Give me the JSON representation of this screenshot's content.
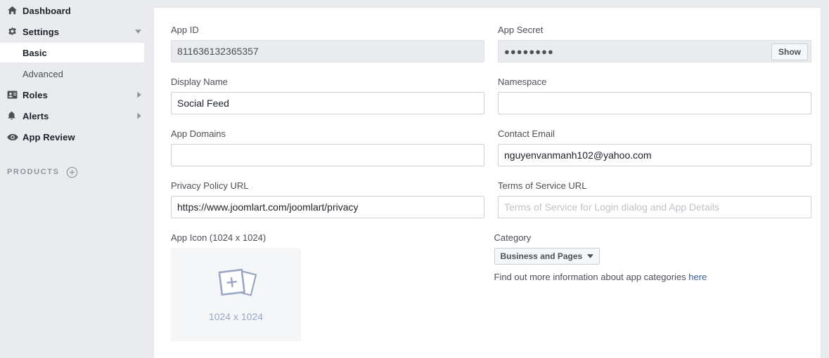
{
  "sidebar": {
    "items": [
      {
        "label": "Dashboard",
        "icon": "home-icon",
        "has_caret": false,
        "caret": ""
      },
      {
        "label": "Settings",
        "icon": "gear-icon",
        "has_caret": true,
        "caret": "down"
      },
      {
        "label": "Roles",
        "icon": "id-card-icon",
        "has_caret": true,
        "caret": "right"
      },
      {
        "label": "Alerts",
        "icon": "bell-icon",
        "has_caret": true,
        "caret": "right"
      },
      {
        "label": "App Review",
        "icon": "eye-icon",
        "has_caret": false,
        "caret": ""
      }
    ],
    "settings_children": [
      {
        "label": "Basic",
        "selected": true
      },
      {
        "label": "Advanced",
        "selected": false
      }
    ],
    "products": {
      "label": "PRODUCTS",
      "add_icon": "plus-circle-icon"
    },
    "background_color": "#e9ebee",
    "selected_background": "#ffffff"
  },
  "form": {
    "app_id": {
      "label": "App ID",
      "value": "811636132365357",
      "disabled": true
    },
    "app_secret": {
      "label": "App Secret",
      "value": "●●●●●●●●",
      "show_button_label": "Show",
      "disabled": true
    },
    "display_name": {
      "label": "Display Name",
      "value": "Social Feed",
      "placeholder": ""
    },
    "namespace": {
      "label": "Namespace",
      "value": "",
      "placeholder": ""
    },
    "app_domains": {
      "label": "App Domains",
      "value": "",
      "placeholder": ""
    },
    "contact_email": {
      "label": "Contact Email",
      "value": "nguyenvanmanh102@yahoo.com",
      "placeholder": ""
    },
    "privacy_policy_url": {
      "label": "Privacy Policy URL",
      "value": "https://www.joomlart.com/joomlart/privacy",
      "placeholder": ""
    },
    "terms_of_service_url": {
      "label": "Terms of Service URL",
      "value": "",
      "placeholder": "Terms of Service for Login dialog and App Details"
    },
    "app_icon": {
      "label": "App Icon (1024 x 1024)",
      "caption": "1024 x 1024",
      "upload_icon": "add-photos-icon"
    },
    "category": {
      "label": "Category",
      "selected": "Business and Pages",
      "caret_icon": "chevron-down-icon",
      "help_prefix": "Find out more information about app categories ",
      "help_link": "here"
    }
  },
  "colors": {
    "page_background": "#e9ebee",
    "card_background": "#ffffff",
    "label_text": "#4b4f56",
    "link_blue": "#3b5998",
    "disabled_field": "#e9ebee",
    "uploader_background": "#f5f6f7",
    "uploader_accent": "#9aa6c4"
  }
}
